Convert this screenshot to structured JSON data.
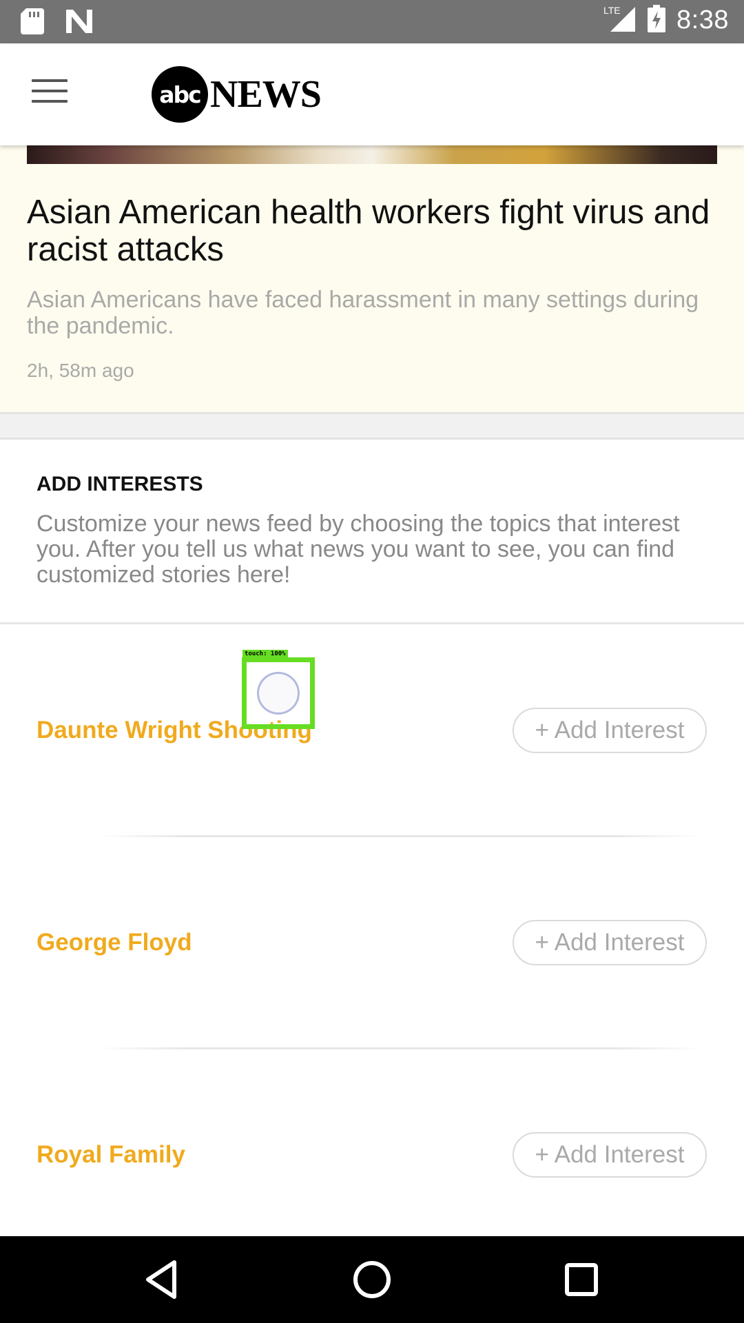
{
  "status_bar": {
    "time": "8:38",
    "network": "LTE",
    "icons": [
      "sd-card-icon",
      "n-notification-icon",
      "lte-signal-icon",
      "battery-charging-icon"
    ]
  },
  "header": {
    "logo_abc": "abc",
    "logo_news": "NEWS",
    "menu_icon": "hamburger-menu-icon"
  },
  "story": {
    "title": "Asian American health workers fight virus and racist attacks",
    "subtitle": "Asian Americans have faced harassment in many settings during the pandemic.",
    "time": "2h, 58m ago"
  },
  "interests": {
    "title": "ADD INTERESTS",
    "description": "Customize your news feed by choosing the topics that interest you. After you tell us what news you want to see, you can find customized stories here!",
    "topics": [
      {
        "name": "Daunte Wright Shooting",
        "button": "+ Add Interest"
      },
      {
        "name": "George Floyd",
        "button": "+ Add Interest"
      },
      {
        "name": "Royal Family",
        "button": "+ Add Interest"
      }
    ]
  },
  "touch_overlay": {
    "label": "touch: 100%"
  },
  "colors": {
    "accent": "#f0aa1e",
    "status_bar": "#737373",
    "story_bg": "#fefcee",
    "nav_bar": "#000000"
  },
  "nav": {
    "icons": [
      "back-icon",
      "home-icon",
      "recents-icon"
    ]
  }
}
